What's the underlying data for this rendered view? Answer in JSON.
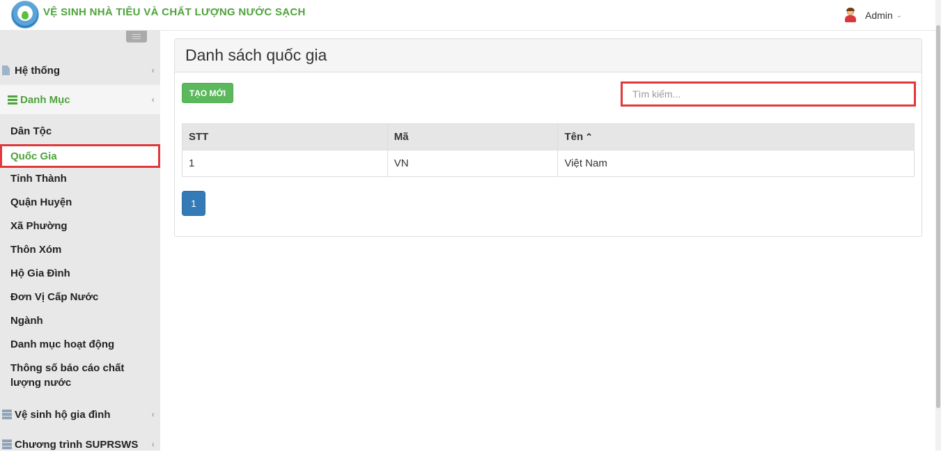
{
  "header": {
    "app_title": "VỆ SINH NHÀ TIÊU VÀ CHẤT LƯỢNG NƯỚC SẠCH",
    "user_name": "Admin"
  },
  "sidebar": {
    "groups": [
      {
        "label": "Hệ thống",
        "icon": "file-icon",
        "active": false
      },
      {
        "label": "Danh Mục",
        "icon": "list-icon",
        "active": true
      },
      {
        "label": "Vệ sinh hộ gia đình",
        "icon": "server-icon",
        "active": false
      },
      {
        "label": "Chương trình SUPRSWS",
        "icon": "server-icon",
        "active": false
      }
    ],
    "danh_muc_items": [
      {
        "label": "Dân Tộc",
        "selected": false
      },
      {
        "label": "Quốc Gia",
        "selected": true
      },
      {
        "label": "Tỉnh Thành",
        "selected": false
      },
      {
        "label": "Quận Huyện",
        "selected": false
      },
      {
        "label": "Xã Phường",
        "selected": false
      },
      {
        "label": "Thôn Xóm",
        "selected": false
      },
      {
        "label": "Hộ Gia Đình",
        "selected": false
      },
      {
        "label": "Đơn Vị Cấp Nước",
        "selected": false
      },
      {
        "label": "Ngành",
        "selected": false
      },
      {
        "label": "Danh mục hoạt động",
        "selected": false
      },
      {
        "label": "Thông số báo cáo chất lượng nước",
        "selected": false
      }
    ]
  },
  "main": {
    "title": "Danh sách quốc gia",
    "create_button": "TẠO MỚI",
    "search": {
      "placeholder": "Tìm kiếm...",
      "value": ""
    },
    "table": {
      "columns": [
        "STT",
        "Mã",
        "Tên"
      ],
      "sorted_column": "Tên",
      "sort_direction": "ascending",
      "rows": [
        [
          "1",
          "VN",
          "Việt Nam"
        ]
      ]
    },
    "pagination": {
      "pages": [
        "1"
      ],
      "current": "1"
    }
  },
  "colors": {
    "brand_green": "#4da23b",
    "highlight_red": "#e0383b",
    "button_green": "#5cb85c",
    "pagination_blue": "#337ab7"
  }
}
